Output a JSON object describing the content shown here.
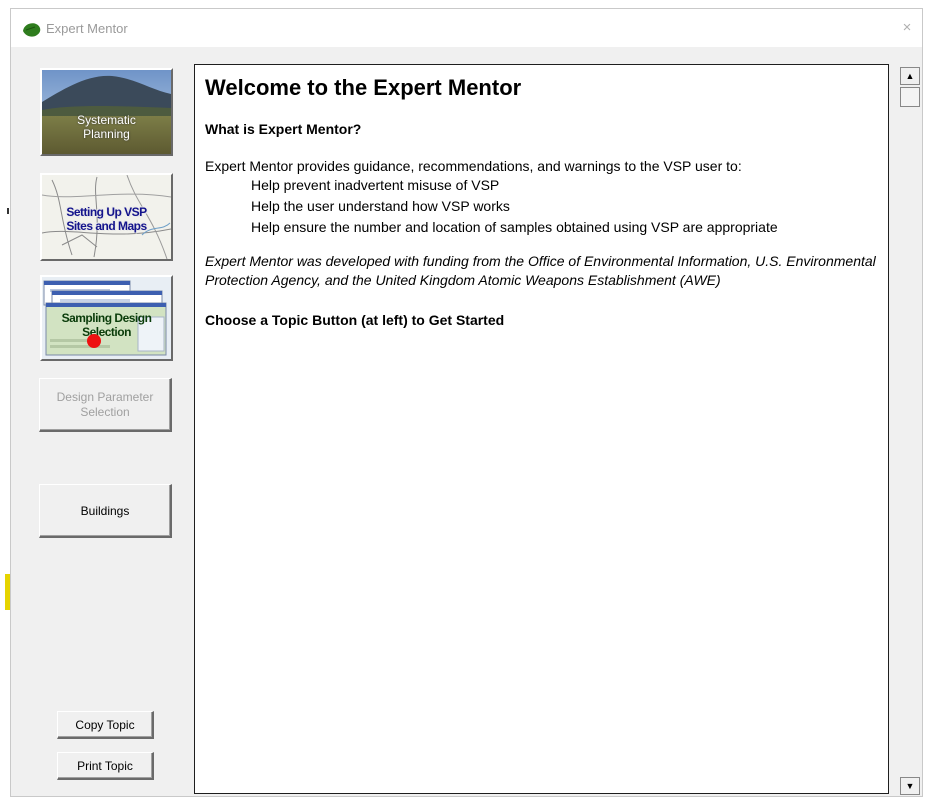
{
  "window": {
    "title": "Expert Mentor",
    "close_glyph": "×"
  },
  "sidebar": {
    "systematic_planning": {
      "line1": "Systematic",
      "line2": "Planning"
    },
    "sites_maps": {
      "line1": "Setting Up VSP",
      "line2": "Sites and Maps"
    },
    "sampling_design": {
      "line1": "Sampling Design",
      "line2": "Selection"
    },
    "design_parameter": {
      "line1": "Design Parameter",
      "line2": "Selection"
    },
    "buildings": "Buildings",
    "copy_topic": "Copy Topic",
    "print_topic": "Print Topic"
  },
  "content": {
    "heading": "Welcome to the Expert Mentor",
    "subheading": "What is Expert Mentor?",
    "intro": "Expert Mentor provides guidance, recommendations, and warnings to the VSP user to:",
    "bullets": [
      "Help prevent inadvertent misuse of VSP",
      "Help the user understand how VSP works",
      "Help ensure the number and location of samples obtained using VSP are appropriate"
    ],
    "funding": "Expert Mentor was developed with funding from the Office of Environmental Information, U.S. Environmental Protection Agency, and the United Kingdom Atomic Weapons Establishment (AWE)",
    "cta": "Choose a Topic Button (at left) to Get Started"
  },
  "scrollbar": {
    "up_glyph": "▲",
    "down_glyph": "▼"
  },
  "icons": {
    "title_icon": "green-leaf-icon",
    "close": "close-icon",
    "sampling_marker": "red-dot-icon"
  },
  "colors": {
    "window_bg": "#f0f0f0",
    "title_text": "#9a9a9a",
    "sites_label": "#14148c",
    "sampling_label": "#0a3c0a",
    "disabled_text": "#a0a0a0",
    "marker_red": "#ee1111",
    "leaf_green": "#2f7d1e"
  }
}
